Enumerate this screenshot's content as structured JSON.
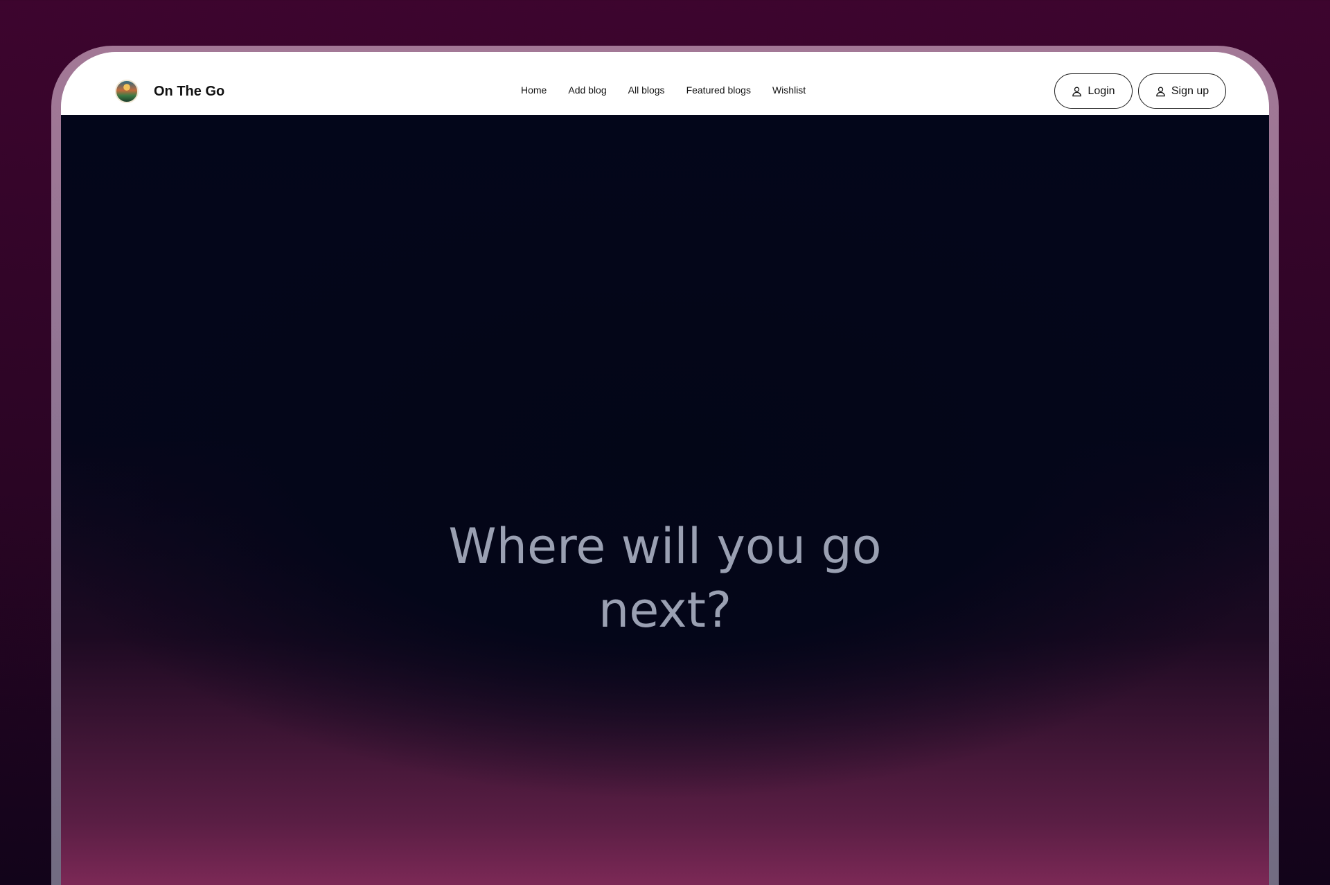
{
  "brand": {
    "name": "On The Go",
    "logo_icon": "landscape-logo-icon"
  },
  "nav": {
    "links": [
      "Home",
      "Add blog",
      "All blogs",
      "Featured blogs",
      "Wishlist"
    ]
  },
  "auth": {
    "login_label": "Login",
    "signup_label": "Sign up",
    "icon": "user-icon"
  },
  "hero": {
    "title_line1": "Where will you go",
    "title_line2": "next?"
  },
  "colors": {
    "outer_bg": "#3d052e",
    "hero_dark": "#03061a",
    "hero_glow": "#8d2e5f",
    "hero_text": "#9aa0b2"
  }
}
